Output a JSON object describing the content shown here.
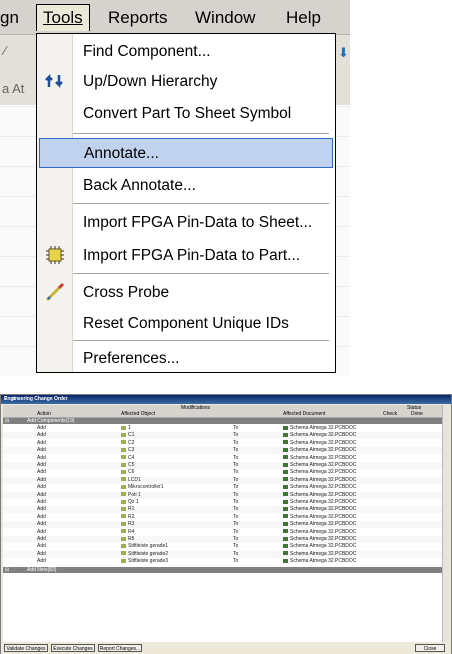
{
  "menubar": {
    "items": [
      "gn",
      "Tools",
      "Reports",
      "Window",
      "Help"
    ]
  },
  "tools_menu": {
    "items": [
      {
        "label": "Find Component...",
        "icon": ""
      },
      {
        "label": "Up/Down Hierarchy",
        "icon": "up-down-hierarchy-icon"
      },
      {
        "label": "Convert Part To Sheet Symbol",
        "icon": ""
      },
      {
        "label": "Annotate...",
        "icon": "",
        "selected": true
      },
      {
        "label": "Back Annotate...",
        "icon": ""
      },
      {
        "label": "Import FPGA Pin-Data to Sheet...",
        "icon": ""
      },
      {
        "label": "Import FPGA Pin-Data to Part...",
        "icon": "chip-icon"
      },
      {
        "label": "Cross Probe",
        "icon": "cross-probe-icon"
      },
      {
        "label": "Reset Component Unique IDs",
        "icon": ""
      },
      {
        "label": "Preferences...",
        "icon": ""
      }
    ]
  },
  "eco": {
    "title": "Engineering Change Order",
    "headers": {
      "modifications": "Modifications",
      "status": "Status",
      "action": "Action",
      "affected_object": "Affected Object",
      "affected_document": "Affected Document",
      "check": "Check",
      "done": "Done"
    },
    "group1": "Add Components(19)",
    "rows": [
      {
        "action": "Add",
        "object": "1",
        "to": "To",
        "doc": "Schema Atmega 32.PCBDOC"
      },
      {
        "action": "Add",
        "object": "C1",
        "to": "To",
        "doc": "Schema Atmega 32.PCBDOC"
      },
      {
        "action": "Add",
        "object": "C2",
        "to": "To",
        "doc": "Schema Atmega 32.PCBDOC"
      },
      {
        "action": "Add",
        "object": "C3",
        "to": "To",
        "doc": "Schema Atmega 32.PCBDOC"
      },
      {
        "action": "Add",
        "object": "C4",
        "to": "To",
        "doc": "Schema Atmega 32.PCBDOC"
      },
      {
        "action": "Add",
        "object": "C5",
        "to": "To",
        "doc": "Schema Atmega 32.PCBDOC"
      },
      {
        "action": "Add",
        "object": "C6",
        "to": "To",
        "doc": "Schema Atmega 32.PCBDOC"
      },
      {
        "action": "Add",
        "object": "LCD1",
        "to": "To",
        "doc": "Schema Atmega 32.PCBDOC"
      },
      {
        "action": "Add",
        "object": "Mikrocontroller1",
        "to": "To",
        "doc": "Schema Atmega 32.PCBDOC"
      },
      {
        "action": "Add",
        "object": "Poti 1",
        "to": "To",
        "doc": "Schema Atmega 32.PCBDOC"
      },
      {
        "action": "Add",
        "object": "Qz 1",
        "to": "To",
        "doc": "Schema Atmega 32.PCBDOC"
      },
      {
        "action": "Add",
        "object": "R1",
        "to": "To",
        "doc": "Schema Atmega 32.PCBDOC"
      },
      {
        "action": "Add",
        "object": "R2",
        "to": "To",
        "doc": "Schema Atmega 32.PCBDOC"
      },
      {
        "action": "Add",
        "object": "R3",
        "to": "To",
        "doc": "Schema Atmega 32.PCBDOC"
      },
      {
        "action": "Add",
        "object": "R4",
        "to": "To",
        "doc": "Schema Atmega 32.PCBDOC"
      },
      {
        "action": "Add",
        "object": "R5",
        "to": "To",
        "doc": "Schema Atmega 32.PCBDOC"
      },
      {
        "action": "Add",
        "object": "Stiftleiste gerade1",
        "to": "To",
        "doc": "Schema Atmega 32.PCBDOC"
      },
      {
        "action": "Add",
        "object": "Stiftleiste gerade2",
        "to": "To",
        "doc": "Schema Atmega 32.PCBDOC"
      },
      {
        "action": "Add",
        "object": "Stiftleiste gerade3",
        "to": "To",
        "doc": "Schema Atmega 32.PCBDOC"
      }
    ],
    "group2": "Add Nets(83)",
    "buttons": {
      "validate": "Validate Changes",
      "execute": "Execute Changes",
      "report": "Report Changes...",
      "close": "Close"
    },
    "title_controls": "? x"
  },
  "toolbar_fragment": {
    "text": "a At"
  }
}
